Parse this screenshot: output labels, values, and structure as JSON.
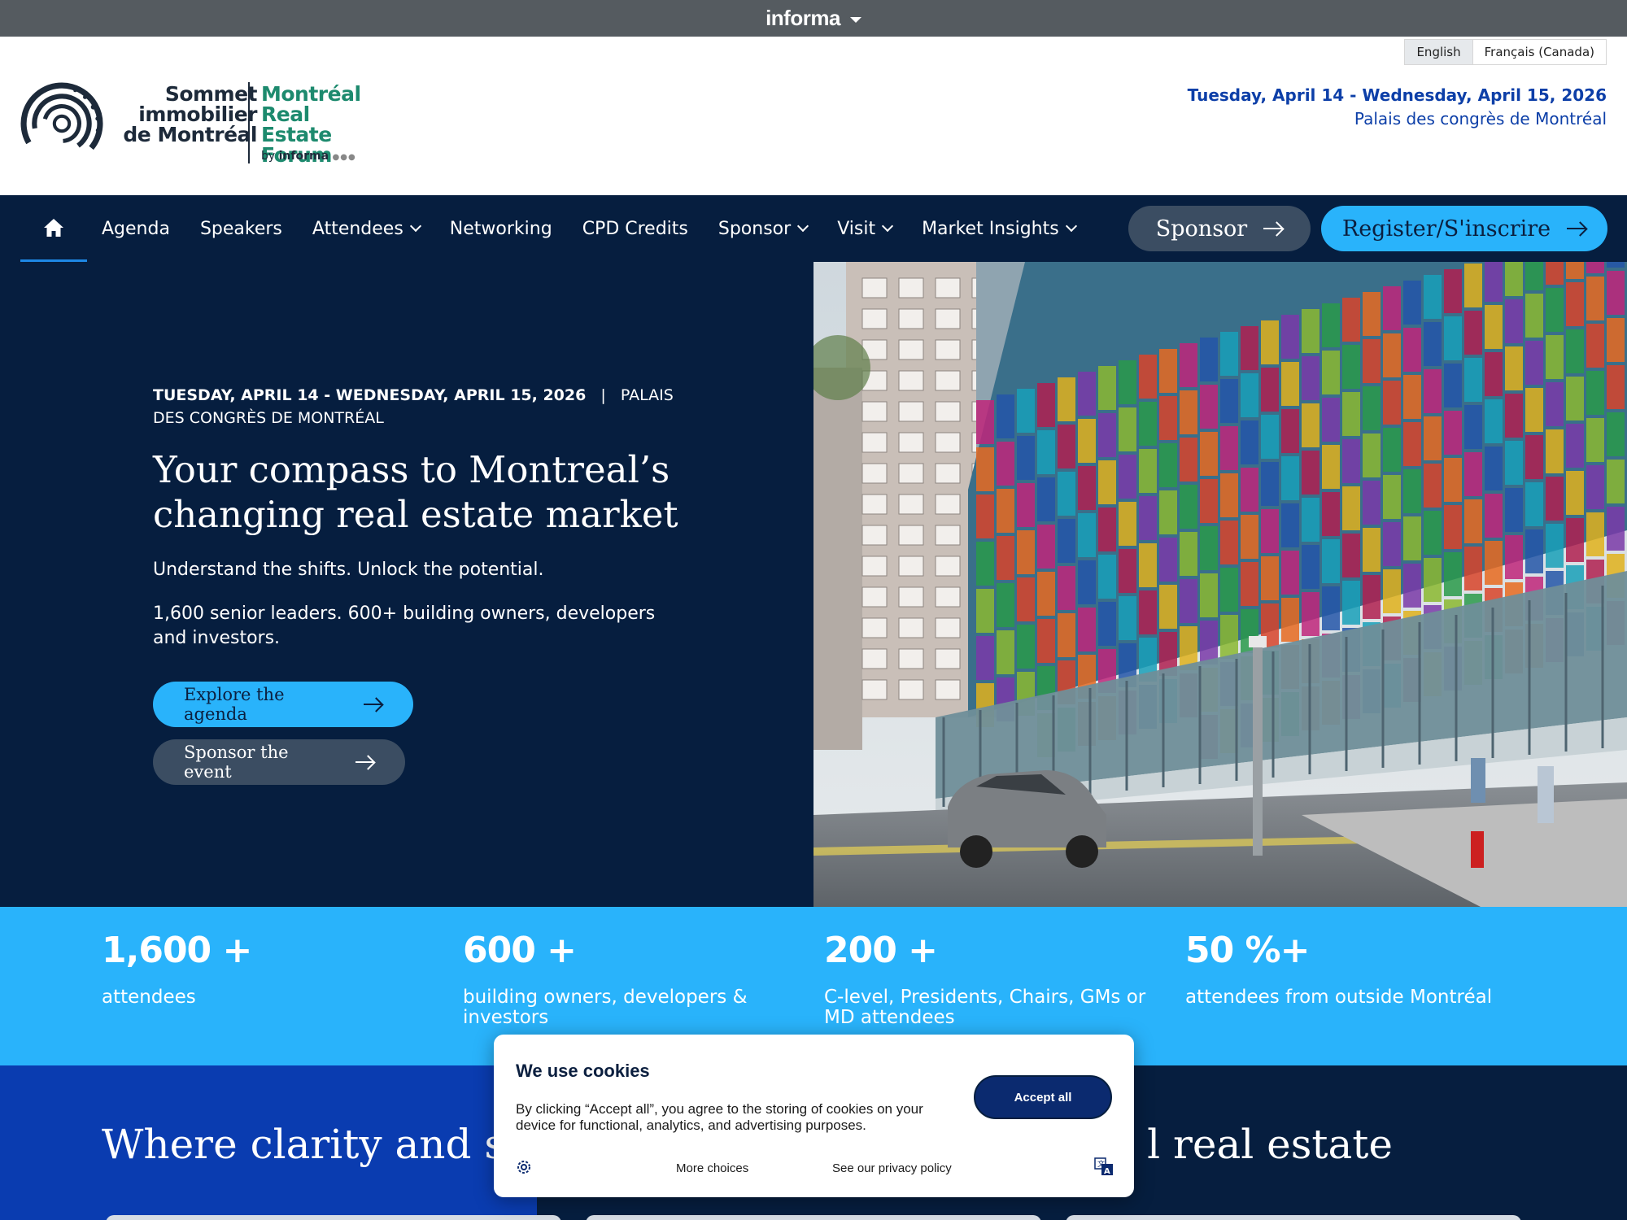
{
  "topbar": {
    "brand": "informa"
  },
  "language": {
    "active": "English",
    "other": "Français (Canada)"
  },
  "logo": {
    "fr_line1": "Sommet",
    "fr_line2": "immobilier",
    "fr_line3": "de Montréal",
    "en_line1": "Montréal",
    "en_line2": "Real Estate",
    "en_line3": "Forum",
    "by_prefix": "by",
    "by_brand": "informa"
  },
  "header": {
    "date": "Tuesday, April 14 - Wednesday, April 15, 2026",
    "venue": "Palais des congrès de Montréal"
  },
  "nav": {
    "items": [
      {
        "label": "Agenda",
        "dropdown": false
      },
      {
        "label": "Speakers",
        "dropdown": false
      },
      {
        "label": "Attendees",
        "dropdown": true
      },
      {
        "label": "Networking",
        "dropdown": false
      },
      {
        "label": "CPD Credits",
        "dropdown": false
      },
      {
        "label": "Sponsor",
        "dropdown": true
      },
      {
        "label": "Visit",
        "dropdown": true
      },
      {
        "label": "Market Insights",
        "dropdown": true
      }
    ],
    "sponsor_button": "Sponsor",
    "register_button": "Register/S'inscrire"
  },
  "hero": {
    "date": "TUESDAY, APRIL 14 - WEDNESDAY, APRIL 15, 2026",
    "separator": "|",
    "venue": "PALAIS DES CONGRÈS DE MONTRÉAL",
    "title": "Your compass to Montreal’s changing real estate market",
    "subtitle1": "Understand the shifts. Unlock the potential.",
    "subtitle2": "1,600 senior leaders. 600+ building owners, developers and investors.",
    "button_agenda": "Explore the agenda",
    "button_sponsor": "Sponsor the event"
  },
  "stats": [
    {
      "number": "1,600 +",
      "label": "attendees"
    },
    {
      "number": "600 +",
      "label": "building owners, developers & investors"
    },
    {
      "number": "200 +",
      "label": "C-level, Presidents, Chairs, GMs or MD attendees"
    },
    {
      "number": "50 %+",
      "label": "attendees from outside Montréal"
    }
  ],
  "bottom": {
    "title_left": "Where clarity and str",
    "title_right": "l real estate"
  },
  "cookie": {
    "title": "We use cookies",
    "text": "By clicking “Accept all”, you agree to the storing of cookies on your device for functional, analytics, and advertising purposes.",
    "accept": "Accept all",
    "more": "More choices",
    "privacy": "See our privacy policy"
  },
  "colors": {
    "navy": "#061e3f",
    "accent_blue": "#29b3fb",
    "logo_green": "#1d8a6e",
    "date_blue": "#0d3fa8"
  },
  "icons": {
    "home": "home-icon",
    "arrow": "arrow-right-icon",
    "chevron": "chevron-down-icon",
    "cookie_settings": "gear-icon",
    "language": "translate-icon"
  }
}
